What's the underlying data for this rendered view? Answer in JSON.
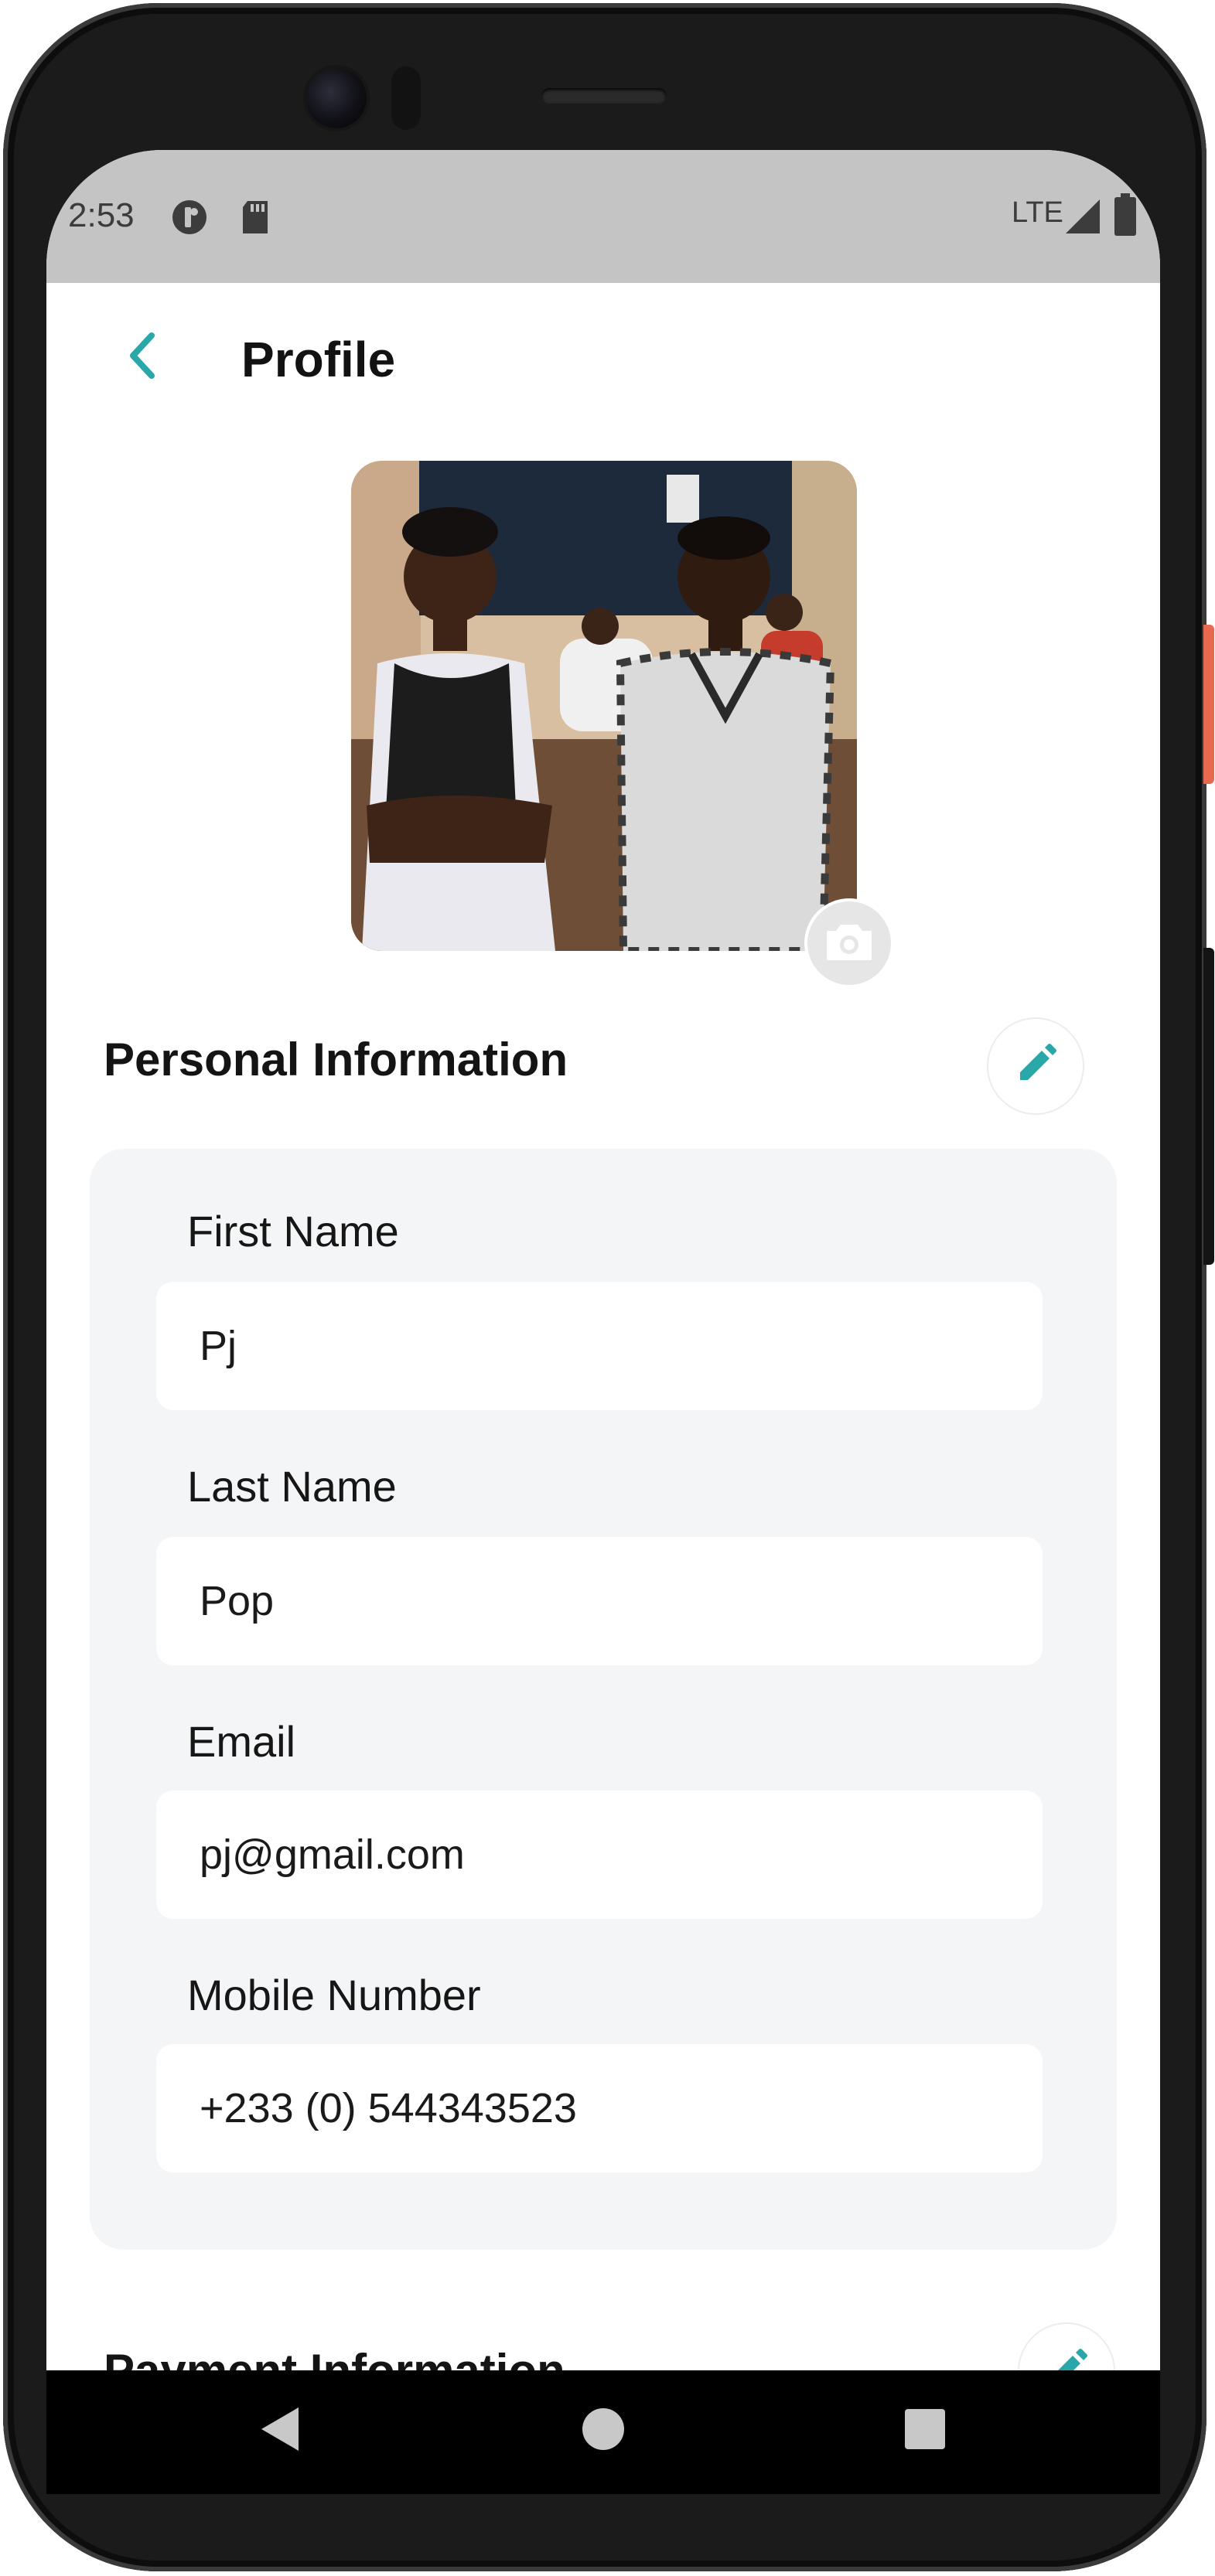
{
  "status_bar": {
    "time": "2:53",
    "network": "LTE",
    "icons": [
      "app-badge-icon",
      "sd-card-icon",
      "signal-icon",
      "battery-icon"
    ]
  },
  "header": {
    "back_icon": "chevron-left-icon",
    "title": "Profile"
  },
  "avatar": {
    "camera_icon": "camera-icon"
  },
  "personal_information": {
    "title": "Personal Information",
    "edit_icon": "pencil-icon",
    "fields": [
      {
        "label": "First Name",
        "value": "Pj"
      },
      {
        "label": "Last Name",
        "value": "Pop"
      },
      {
        "label": "Email",
        "value": "pj@gmail.com"
      },
      {
        "label": "Mobile Number",
        "value": "+233 (0) 544343523"
      }
    ]
  },
  "payment_information": {
    "title": "Payment Information",
    "edit_icon": "pencil-icon"
  },
  "nav_bar": {
    "icons": [
      "nav-back-icon",
      "nav-home-icon",
      "nav-recents-icon"
    ]
  },
  "colors": {
    "accent": "#2aa7a8",
    "status_bar": "#c4c4c4",
    "card_background": "#f4f5f6",
    "text": "#121212"
  }
}
